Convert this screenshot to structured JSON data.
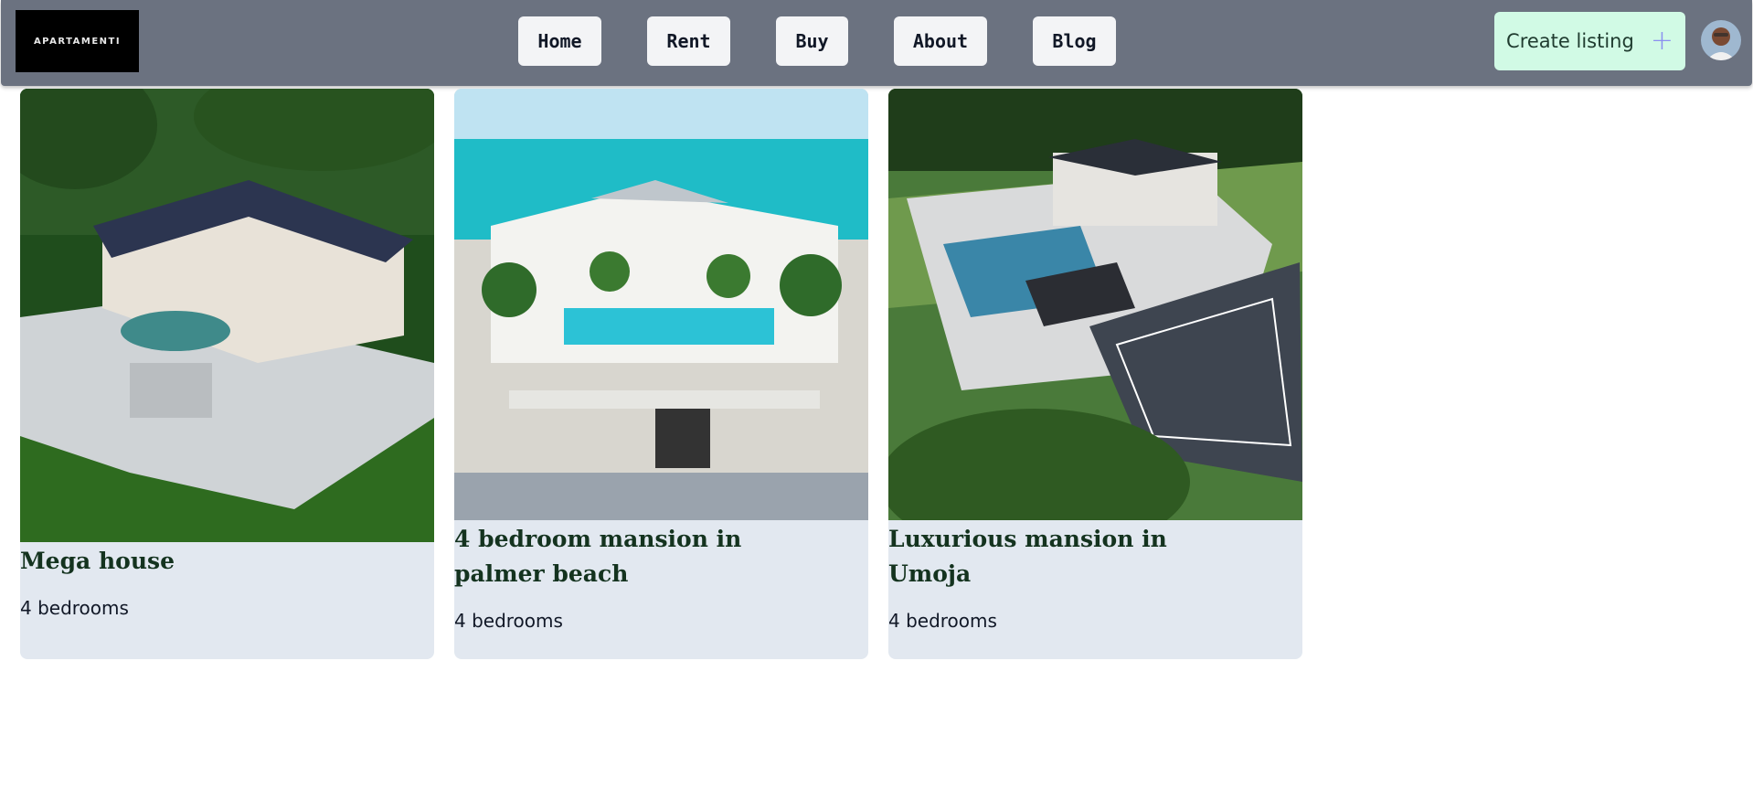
{
  "header": {
    "logo_text": "APARTAMENTI",
    "nav": [
      {
        "label": "Home"
      },
      {
        "label": "Rent"
      },
      {
        "label": "Buy"
      },
      {
        "label": "About"
      },
      {
        "label": "Blog"
      }
    ],
    "create_label": "Create listing",
    "create_icon": "plus-icon",
    "avatar_icon": "user-avatar"
  },
  "listings": [
    {
      "title": "Mega house",
      "bedrooms": "4 bedrooms"
    },
    {
      "title": "4 bedroom mansion in palmer beach",
      "bedrooms": "4 bedrooms"
    },
    {
      "title": "Luxurious mansion in Umoja",
      "bedrooms": "4 bedrooms"
    }
  ],
  "colors": {
    "navbar": "#6b7280",
    "nav_button": "#f3f4f6",
    "create_button": "#d1fae5",
    "card": "#e2e8f0",
    "title": "#14331f"
  }
}
